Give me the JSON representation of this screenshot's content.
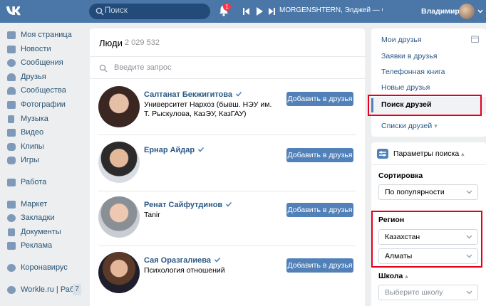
{
  "header": {
    "search_placeholder": "Поиск",
    "notifications_count": "1",
    "now_playing": "MORGENSHTERN, Элджей — Cadill...",
    "user_name": "Владимир"
  },
  "left_menu": {
    "items": [
      {
        "label": "Моя страница",
        "icon": "user-icon"
      },
      {
        "label": "Новости",
        "icon": "news-icon"
      },
      {
        "label": "Сообщения",
        "icon": "messages-icon"
      },
      {
        "label": "Друзья",
        "icon": "friends-icon"
      },
      {
        "label": "Сообщества",
        "icon": "communities-icon"
      },
      {
        "label": "Фотографии",
        "icon": "camera-icon"
      },
      {
        "label": "Музыка",
        "icon": "music-icon"
      },
      {
        "label": "Видео",
        "icon": "video-icon"
      },
      {
        "label": "Клипы",
        "icon": "clips-icon"
      },
      {
        "label": "Игры",
        "icon": "games-icon"
      }
    ],
    "work": {
      "label": "Работа",
      "icon": "briefcase-icon"
    },
    "items2": [
      {
        "label": "Маркет",
        "icon": "bag-icon"
      },
      {
        "label": "Закладки",
        "icon": "star-icon"
      },
      {
        "label": "Документы",
        "icon": "document-icon"
      },
      {
        "label": "Реклама",
        "icon": "ads-icon"
      }
    ],
    "corona": {
      "label": "Коронавирус",
      "icon": "virus-icon"
    },
    "app": {
      "label": "Workle.ru | Раб...",
      "count": "7",
      "icon": "app-icon"
    }
  },
  "main": {
    "title": "Люди",
    "count": "2 029 532",
    "query_placeholder": "Введите запрос",
    "add_label": "Добавить в друзья",
    "people": [
      {
        "name": "Салтанат Бекжигитова",
        "desc": "Университет Нархоз (бывш. НЭУ им. Т. Рыскулова, КазЭУ, КазГАУ)"
      },
      {
        "name": "Ернар Айдар",
        "desc": ""
      },
      {
        "name": "Ренат Сайфутдинов",
        "desc": "Tanir"
      },
      {
        "name": "Сая Оразгалиева",
        "desc": "Психология отношений"
      }
    ]
  },
  "right_menu": {
    "items": [
      "Мои друзья",
      "Заявки в друзья",
      "Телефонная книга",
      "Новые друзья",
      "Поиск друзей"
    ],
    "lists": "Списки друзей"
  },
  "filter": {
    "title": "Параметры поиска",
    "sort_label": "Сортировка",
    "sort_value": "По популярности",
    "region_label": "Регион",
    "country": "Казахстан",
    "city": "Алматы",
    "school_label": "Школа",
    "school_placeholder": "Выберите школу"
  },
  "colors": {
    "header": "#4a76a8",
    "accent": "#5181b8",
    "highlight": "#e3001b"
  }
}
